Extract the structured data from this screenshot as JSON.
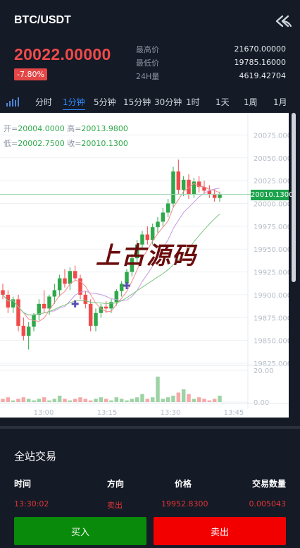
{
  "header": {
    "title": "BTC/USDT",
    "back_icon": "double-back-arrow-icon"
  },
  "ticker": {
    "last_price": "20022.00000",
    "change_pct": "-7.80%",
    "stats": [
      {
        "label": "最高价",
        "value": "21670.00000"
      },
      {
        "label": "最低价",
        "value": "19785.16000"
      },
      {
        "label": "24H量",
        "value": "4619.42704"
      }
    ]
  },
  "tabs": {
    "depth_icon": "depth-chart-icon",
    "items": [
      {
        "label": "分时"
      },
      {
        "label": "1分钟",
        "active": true
      },
      {
        "label": "5分钟"
      },
      {
        "label": "15分钟"
      },
      {
        "label": "30分钟"
      },
      {
        "label": "1时"
      },
      {
        "label": "1天"
      },
      {
        "label": "1周"
      },
      {
        "label": "1月"
      }
    ]
  },
  "ohlc": {
    "open_label": "开=",
    "open": "20004.0000",
    "high_label": "高=",
    "high": "20013.9800",
    "low_label": "低=",
    "low": "20002.7500",
    "close_label": "收=",
    "close": "20010.1300"
  },
  "last_price_tag": "20010.1300",
  "watermark": "上古源码",
  "chart_data": {
    "type": "candlestick",
    "y_ticks": [
      "20075.0000",
      "20050.0000",
      "20025.0000",
      "20000.0000",
      "19975.0000",
      "19950.0000",
      "19925.0000",
      "19900.0000",
      "19875.0000",
      "19850.0000",
      "19825.0000"
    ],
    "ylim": [
      19825,
      20090
    ],
    "volume_ticks": [
      "20.00",
      "0.00"
    ],
    "x_ticks": [
      "13:00",
      "13:15",
      "13:30",
      "13:45"
    ],
    "colors": {
      "up": "#2ea84a",
      "down": "#f04a4a"
    },
    "candles": [
      [
        19905,
        19912,
        19895,
        19900
      ],
      [
        19900,
        19905,
        19880,
        19886
      ],
      [
        19886,
        19898,
        19880,
        19895
      ],
      [
        19895,
        19900,
        19860,
        19866
      ],
      [
        19866,
        19875,
        19850,
        19855
      ],
      [
        19855,
        19870,
        19840,
        19865
      ],
      [
        19865,
        19880,
        19860,
        19878
      ],
      [
        19878,
        19895,
        19872,
        19890
      ],
      [
        19890,
        19905,
        19880,
        19885
      ],
      [
        19885,
        19900,
        19878,
        19898
      ],
      [
        19898,
        19912,
        19890,
        19905
      ],
      [
        19905,
        19922,
        19898,
        19918
      ],
      [
        19918,
        19928,
        19908,
        19912
      ],
      [
        19912,
        19930,
        19905,
        19926
      ],
      [
        19926,
        19932,
        19915,
        19918
      ],
      [
        19918,
        19922,
        19895,
        19900
      ],
      [
        19900,
        19904,
        19885,
        19890
      ],
      [
        19890,
        19895,
        19860,
        19866
      ],
      [
        19866,
        19885,
        19860,
        19880
      ],
      [
        19880,
        19890,
        19875,
        19887
      ],
      [
        19887,
        19893,
        19880,
        19885
      ],
      [
        19885,
        19895,
        19880,
        19892
      ],
      [
        19892,
        19906,
        19888,
        19904
      ],
      [
        19904,
        19915,
        19898,
        19912
      ],
      [
        19912,
        19928,
        19908,
        19925
      ],
      [
        19925,
        19945,
        19920,
        19940
      ],
      [
        19940,
        19960,
        19935,
        19955
      ],
      [
        19955,
        19970,
        19950,
        19966
      ],
      [
        19966,
        19975,
        19955,
        19960
      ],
      [
        19960,
        19978,
        19955,
        19974
      ],
      [
        19974,
        19985,
        19968,
        19980
      ],
      [
        19980,
        19995,
        19975,
        19990
      ],
      [
        19990,
        20005,
        19985,
        20000
      ],
      [
        20000,
        20040,
        19995,
        20035
      ],
      [
        20035,
        20048,
        20010,
        20015
      ],
      [
        20015,
        20030,
        20008,
        20026
      ],
      [
        20026,
        20032,
        20005,
        20010
      ],
      [
        20010,
        20028,
        20006,
        20024
      ],
      [
        20024,
        20030,
        20012,
        20018
      ],
      [
        20018,
        20025,
        20010,
        20014
      ],
      [
        20014,
        20020,
        20006,
        20010
      ],
      [
        20010,
        20016,
        20002,
        20006
      ],
      [
        20006,
        20013,
        20002,
        20010
      ]
    ],
    "volumes": [
      2,
      3,
      1,
      2,
      3,
      2,
      1,
      2,
      3,
      1,
      2,
      4,
      2,
      1,
      2,
      3,
      2,
      1,
      2,
      3,
      2,
      1,
      3,
      2,
      1,
      2,
      3,
      5,
      2,
      3,
      16,
      2,
      3,
      4,
      6,
      8,
      5,
      2,
      3,
      2,
      1,
      2,
      4
    ]
  },
  "trades": {
    "title": "全站交易",
    "headers": {
      "time": "时间",
      "direction": "方向",
      "price": "价格",
      "amount": "交易数量"
    },
    "rows": [
      {
        "time": "13:30:02",
        "direction": "卖出",
        "price": "19952.8300",
        "amount": "0.005043"
      }
    ]
  },
  "actions": {
    "buy": "买入",
    "sell": "卖出"
  }
}
